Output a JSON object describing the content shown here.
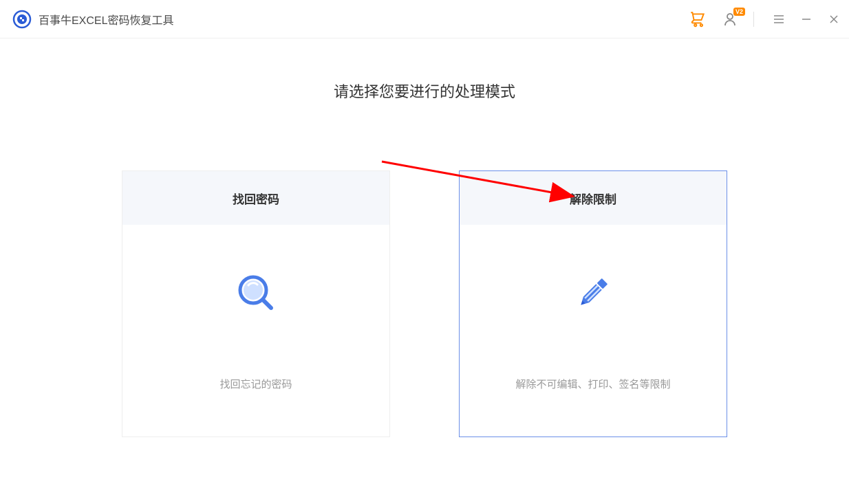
{
  "header": {
    "app_title": "百事牛EXCEL密码恢复工具",
    "user_badge": "V2"
  },
  "main": {
    "page_title": "请选择您要进行的处理模式",
    "cards": [
      {
        "title": "找回密码",
        "desc": "找回忘记的密码",
        "selected": false
      },
      {
        "title": "解除限制",
        "desc": "解除不可编辑、打印、签名等限制",
        "selected": true
      }
    ]
  },
  "colors": {
    "accent": "#6b8fe8",
    "highlight": "#ff8a00",
    "cart": "#ff8a00"
  }
}
